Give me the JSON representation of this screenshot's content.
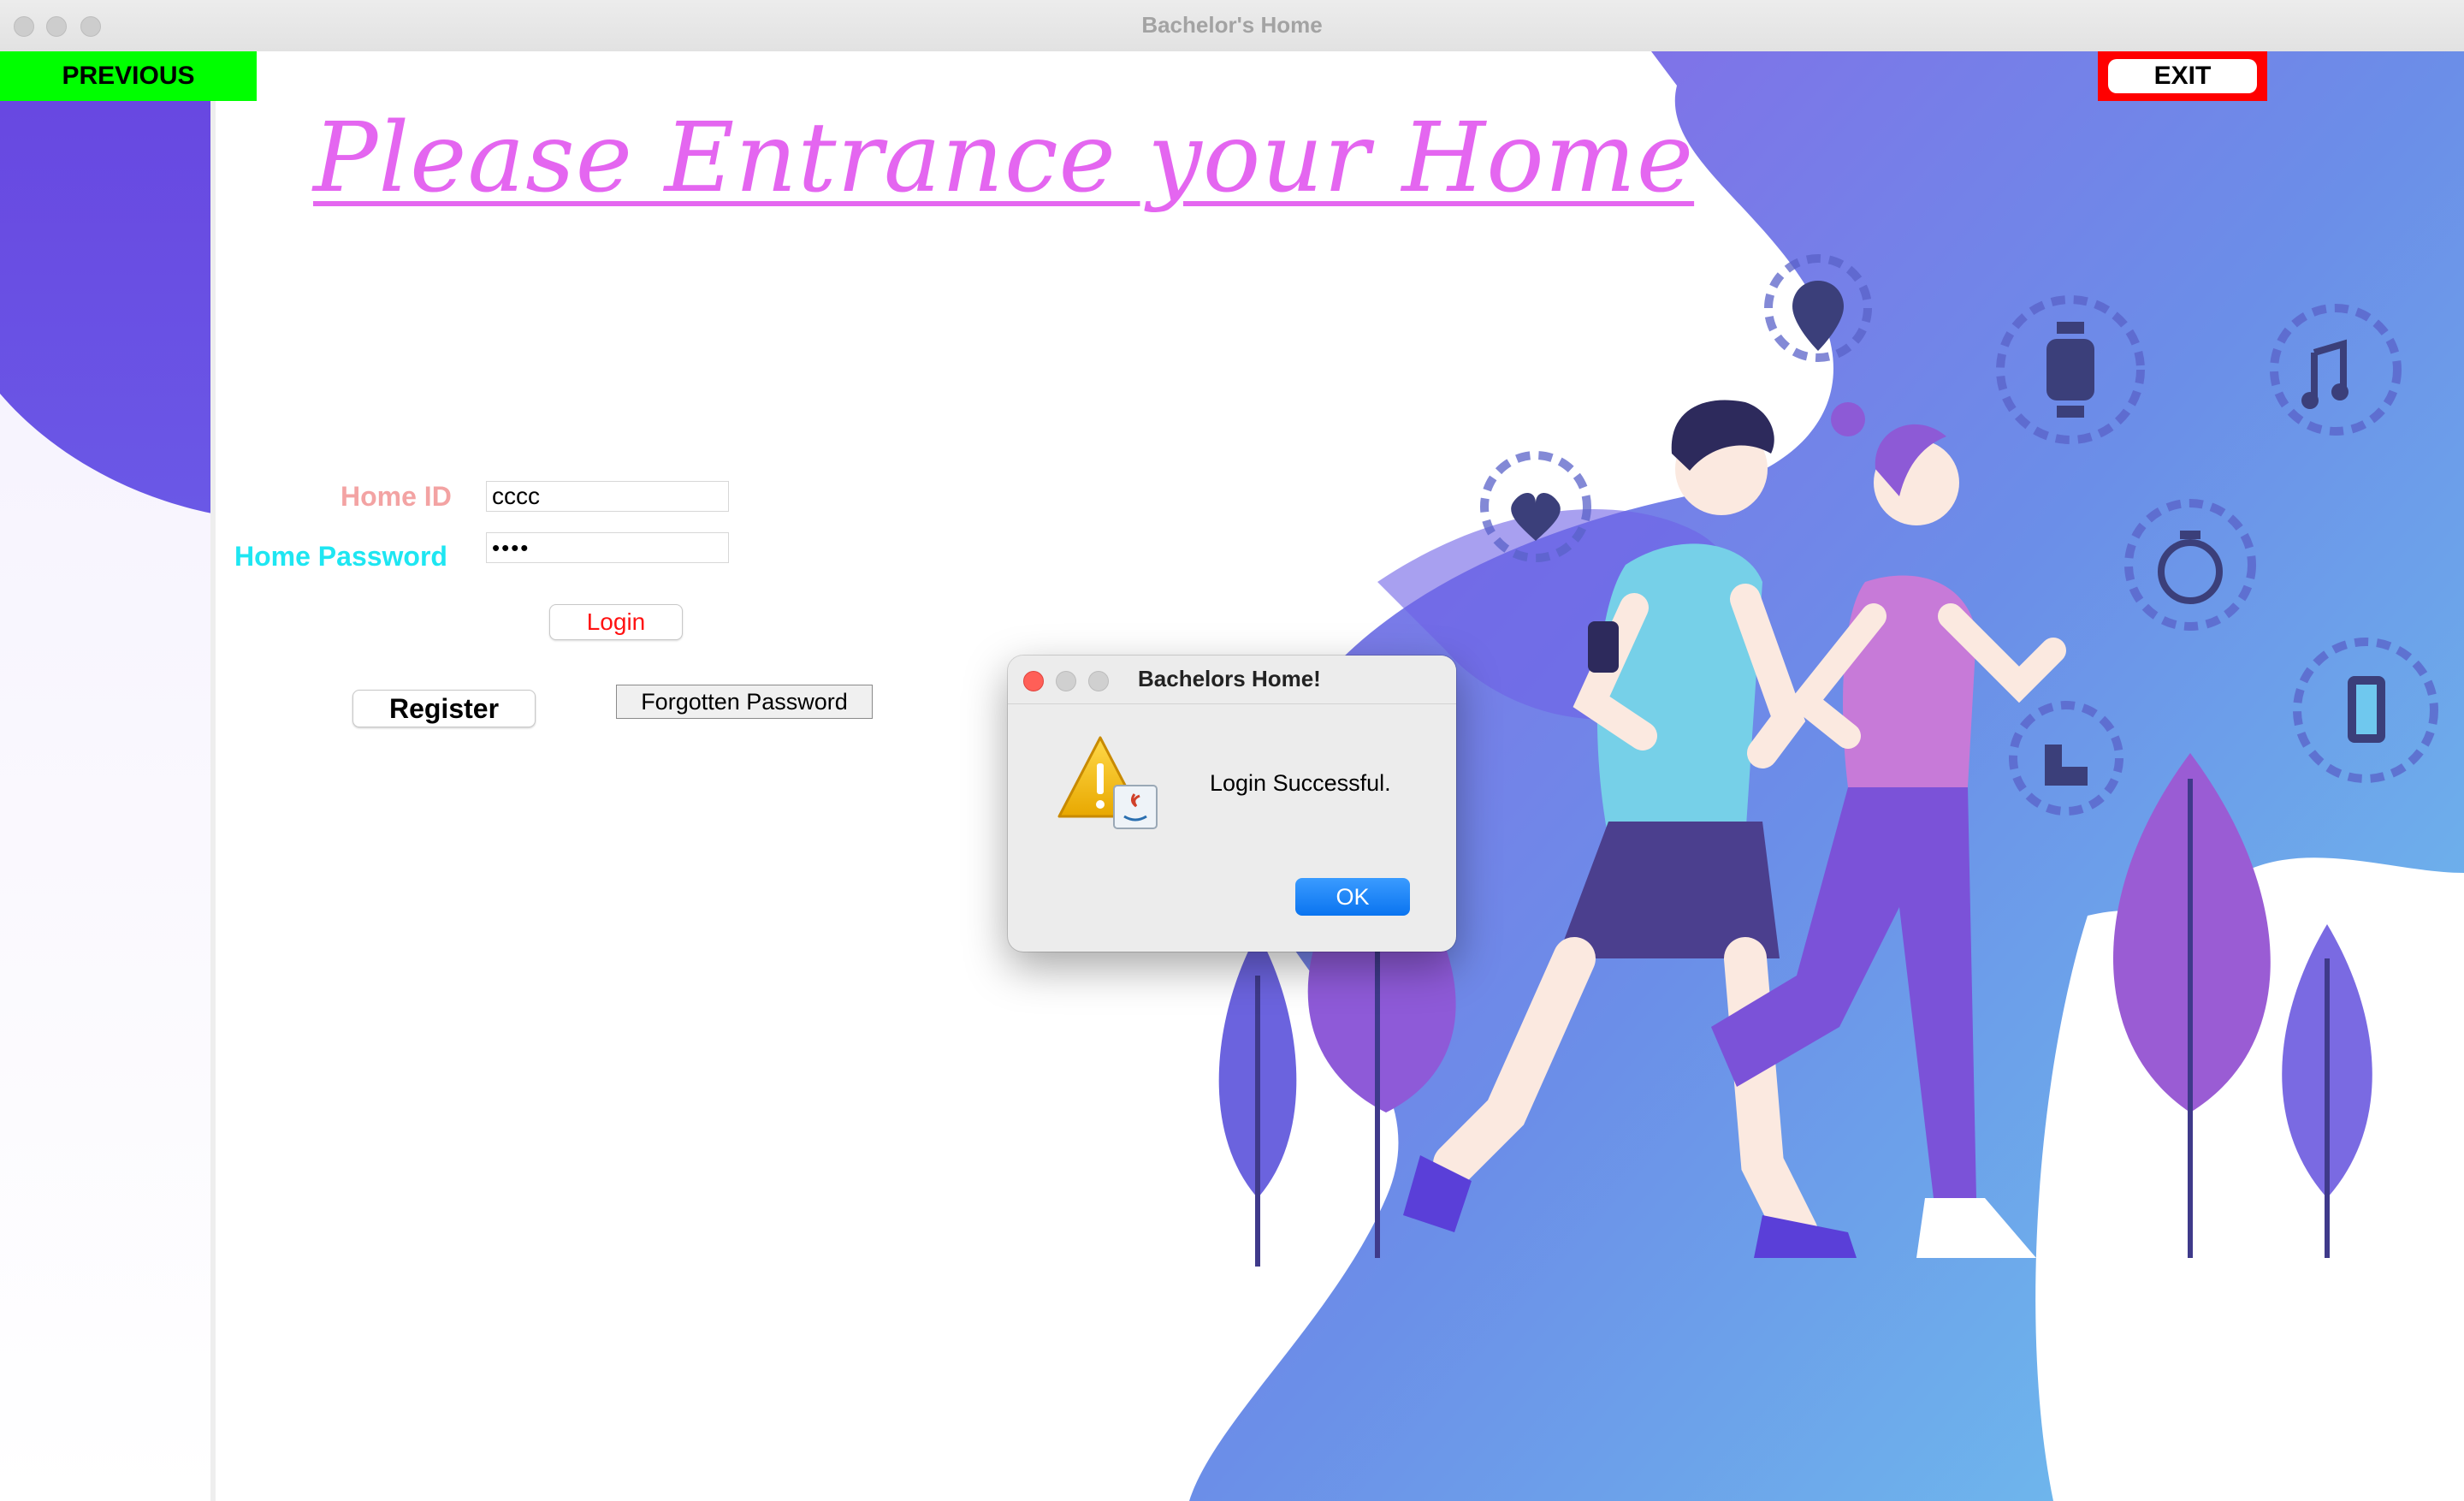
{
  "window": {
    "title": "Bachelor's Home"
  },
  "nav": {
    "previous_label": "PREVIOUS",
    "exit_label": "EXIT"
  },
  "heading": "Please Entrance your Home",
  "form": {
    "home_id_label": "Home ID",
    "home_id_value": "cccc",
    "password_label": "Home Password",
    "password_value": "••••",
    "login_label": "Login",
    "register_label": "Register",
    "forgot_label": "Forgotten Password"
  },
  "dialog": {
    "title": "Bachelors Home!",
    "message": "Login Successful.",
    "ok_label": "OK",
    "icon": "warning-icon"
  },
  "colors": {
    "previous_bg": "#00ff00",
    "exit_border": "#ff0000",
    "heading": "#e466f0",
    "home_id_label": "#f3a3a3",
    "password_label": "#1ee6f2",
    "login_text": "#ff1212",
    "ok_button": "#0a74f0"
  }
}
